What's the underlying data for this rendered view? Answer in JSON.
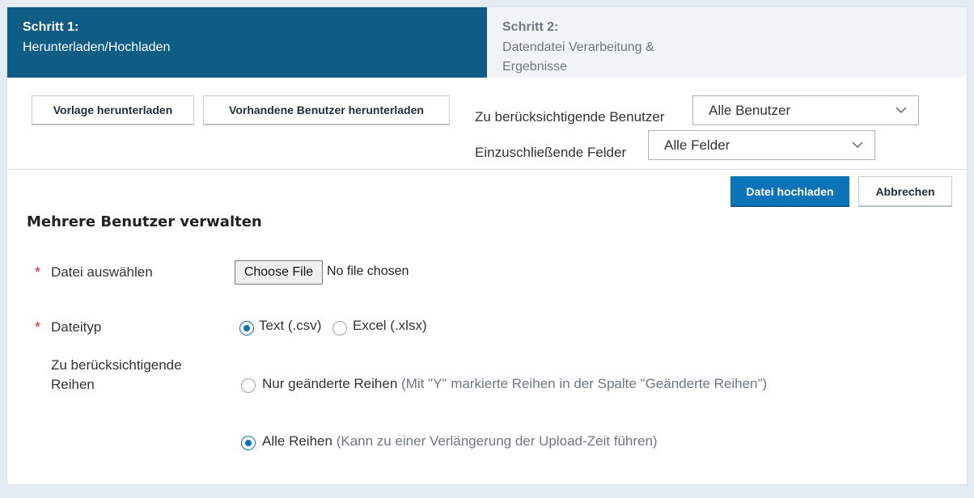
{
  "steps": {
    "step1": {
      "title": "Schritt 1:",
      "desc": "Herunterladen/Hochladen"
    },
    "step2": {
      "title": "Schritt 2:",
      "desc": "Datendatei Verarbeitung & Ergebnisse"
    }
  },
  "toolbar": {
    "download_template": "Vorlage herunterladen",
    "download_users": "Vorhandene Benutzer herunterladen",
    "users_label": "Zu berücksichtigende Benutzer",
    "users_value": "Alle Benutzer",
    "fields_label": "Einzuschließende Felder",
    "fields_value": "Alle Felder"
  },
  "actions": {
    "upload": "Datei hochladen",
    "cancel": "Abbrechen"
  },
  "form": {
    "title": "Mehrere Benutzer verwalten",
    "required_mark": "*",
    "file_label": "Datei auswählen",
    "file_button": "Choose File",
    "file_status": "No file chosen",
    "type_label": "Dateityp",
    "type_csv": "Text (.csv)",
    "type_xlsx": "Excel (.xlsx)",
    "rows_label": "Zu berücksichtigende Reihen",
    "rows_changed": "Nur geänderte Reihen",
    "rows_changed_note": "(Mit \"Y\" markierte Reihen in der Spalte \"Geänderte Reihen\")",
    "rows_all": "Alle Reihen",
    "rows_all_note": "(Kann zu einer Verlängerung der Upload-Zeit führen)"
  },
  "colors": {
    "step_active": "#0e5d84",
    "primary": "#0b74b8",
    "required": "#d2242a"
  }
}
